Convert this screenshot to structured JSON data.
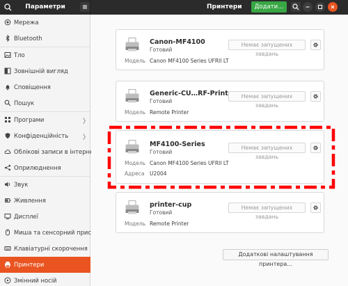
{
  "header": {
    "settings_title": "Параметри",
    "page_title": "Принтери",
    "add_button": "Додати..."
  },
  "sidebar": {
    "items": [
      {
        "label": "Мережа",
        "icon": "network-icon"
      },
      {
        "label": "Bluetooth",
        "icon": "bluetooth-icon"
      },
      {
        "label": "Тло",
        "icon": "background-icon"
      },
      {
        "label": "Зовнішній вигляд",
        "icon": "appearance-icon"
      },
      {
        "label": "Сповіщення",
        "icon": "bell-icon"
      },
      {
        "label": "Пошук",
        "icon": "search-icon"
      },
      {
        "label": "Програми",
        "icon": "apps-icon",
        "chevron": "〉"
      },
      {
        "label": "Конфіденційність",
        "icon": "privacy-icon",
        "chevron": "〉"
      },
      {
        "label": "Облікові записи в інтернеті",
        "icon": "cloud-icon"
      },
      {
        "label": "Оприлюднення",
        "icon": "share-icon"
      },
      {
        "label": "Звук",
        "icon": "speaker-icon"
      },
      {
        "label": "Живлення",
        "icon": "power-icon"
      },
      {
        "label": "Дисплеї",
        "icon": "display-icon"
      },
      {
        "label": "Миша та сенсорний пристрій",
        "icon": "mouse-icon"
      },
      {
        "label": "Клавіатурні скорочення",
        "icon": "keyboard-icon"
      },
      {
        "label": "Принтери",
        "icon": "printer-icon",
        "active": true
      },
      {
        "label": "Змінний носій",
        "icon": "media-icon"
      }
    ]
  },
  "printers": [
    {
      "name": "Canon-MF4100",
      "status": "Готовий",
      "jobs": "Немає запущених завдань",
      "model_label": "Модель",
      "model": "Canon MF4100 Series UFRII LT"
    },
    {
      "name": "Generic-CU…RF-Printer",
      "status": "Готовий",
      "jobs": "Немає запущених завдань",
      "model_label": "Модель",
      "model": "Remote Printer"
    },
    {
      "name": "MF4100-Series",
      "status": "Готовий",
      "jobs": "Немає запущених завдань",
      "model_label": "Модель",
      "model": "Canon MF4100 Series UFRII LT",
      "address_label": "Адреса",
      "address": "U2004"
    },
    {
      "name": "printer-cup",
      "status": "Готовий",
      "jobs": "Немає запущених завдань",
      "model_label": "Модель",
      "model": "Remote Printer"
    }
  ],
  "more_settings_button": "Додаткові налаштування принтера...",
  "colors": {
    "accent": "#e95420",
    "add_button": "#38a744",
    "highlight": "#ff0000"
  }
}
